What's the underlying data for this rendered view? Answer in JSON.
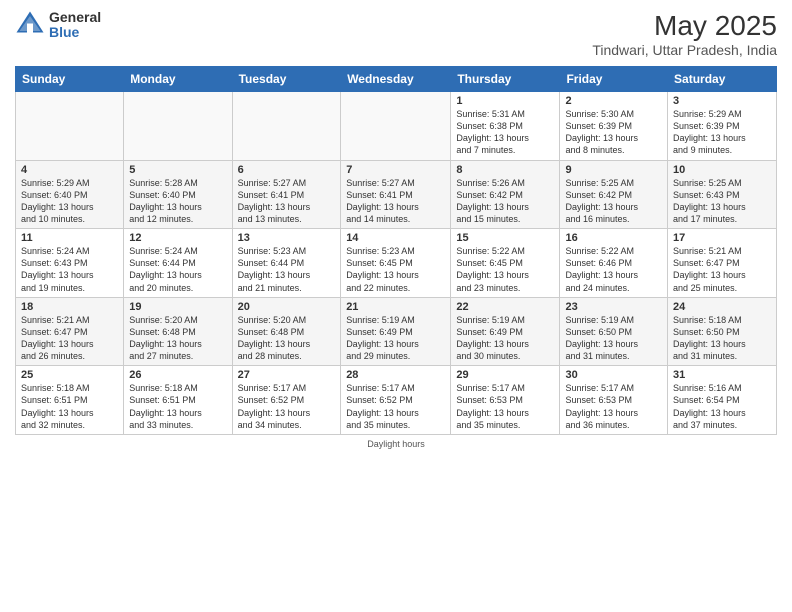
{
  "logo": {
    "general": "General",
    "blue": "Blue"
  },
  "header": {
    "month": "May 2025",
    "location": "Tindwari, Uttar Pradesh, India"
  },
  "days": [
    "Sunday",
    "Monday",
    "Tuesday",
    "Wednesday",
    "Thursday",
    "Friday",
    "Saturday"
  ],
  "weeks": [
    [
      {
        "day": "",
        "info": ""
      },
      {
        "day": "",
        "info": ""
      },
      {
        "day": "",
        "info": ""
      },
      {
        "day": "",
        "info": ""
      },
      {
        "day": "1",
        "info": "Sunrise: 5:31 AM\nSunset: 6:38 PM\nDaylight: 13 hours\nand 7 minutes."
      },
      {
        "day": "2",
        "info": "Sunrise: 5:30 AM\nSunset: 6:39 PM\nDaylight: 13 hours\nand 8 minutes."
      },
      {
        "day": "3",
        "info": "Sunrise: 5:29 AM\nSunset: 6:39 PM\nDaylight: 13 hours\nand 9 minutes."
      }
    ],
    [
      {
        "day": "4",
        "info": "Sunrise: 5:29 AM\nSunset: 6:40 PM\nDaylight: 13 hours\nand 10 minutes."
      },
      {
        "day": "5",
        "info": "Sunrise: 5:28 AM\nSunset: 6:40 PM\nDaylight: 13 hours\nand 12 minutes."
      },
      {
        "day": "6",
        "info": "Sunrise: 5:27 AM\nSunset: 6:41 PM\nDaylight: 13 hours\nand 13 minutes."
      },
      {
        "day": "7",
        "info": "Sunrise: 5:27 AM\nSunset: 6:41 PM\nDaylight: 13 hours\nand 14 minutes."
      },
      {
        "day": "8",
        "info": "Sunrise: 5:26 AM\nSunset: 6:42 PM\nDaylight: 13 hours\nand 15 minutes."
      },
      {
        "day": "9",
        "info": "Sunrise: 5:25 AM\nSunset: 6:42 PM\nDaylight: 13 hours\nand 16 minutes."
      },
      {
        "day": "10",
        "info": "Sunrise: 5:25 AM\nSunset: 6:43 PM\nDaylight: 13 hours\nand 17 minutes."
      }
    ],
    [
      {
        "day": "11",
        "info": "Sunrise: 5:24 AM\nSunset: 6:43 PM\nDaylight: 13 hours\nand 19 minutes."
      },
      {
        "day": "12",
        "info": "Sunrise: 5:24 AM\nSunset: 6:44 PM\nDaylight: 13 hours\nand 20 minutes."
      },
      {
        "day": "13",
        "info": "Sunrise: 5:23 AM\nSunset: 6:44 PM\nDaylight: 13 hours\nand 21 minutes."
      },
      {
        "day": "14",
        "info": "Sunrise: 5:23 AM\nSunset: 6:45 PM\nDaylight: 13 hours\nand 22 minutes."
      },
      {
        "day": "15",
        "info": "Sunrise: 5:22 AM\nSunset: 6:45 PM\nDaylight: 13 hours\nand 23 minutes."
      },
      {
        "day": "16",
        "info": "Sunrise: 5:22 AM\nSunset: 6:46 PM\nDaylight: 13 hours\nand 24 minutes."
      },
      {
        "day": "17",
        "info": "Sunrise: 5:21 AM\nSunset: 6:47 PM\nDaylight: 13 hours\nand 25 minutes."
      }
    ],
    [
      {
        "day": "18",
        "info": "Sunrise: 5:21 AM\nSunset: 6:47 PM\nDaylight: 13 hours\nand 26 minutes."
      },
      {
        "day": "19",
        "info": "Sunrise: 5:20 AM\nSunset: 6:48 PM\nDaylight: 13 hours\nand 27 minutes."
      },
      {
        "day": "20",
        "info": "Sunrise: 5:20 AM\nSunset: 6:48 PM\nDaylight: 13 hours\nand 28 minutes."
      },
      {
        "day": "21",
        "info": "Sunrise: 5:19 AM\nSunset: 6:49 PM\nDaylight: 13 hours\nand 29 minutes."
      },
      {
        "day": "22",
        "info": "Sunrise: 5:19 AM\nSunset: 6:49 PM\nDaylight: 13 hours\nand 30 minutes."
      },
      {
        "day": "23",
        "info": "Sunrise: 5:19 AM\nSunset: 6:50 PM\nDaylight: 13 hours\nand 31 minutes."
      },
      {
        "day": "24",
        "info": "Sunrise: 5:18 AM\nSunset: 6:50 PM\nDaylight: 13 hours\nand 31 minutes."
      }
    ],
    [
      {
        "day": "25",
        "info": "Sunrise: 5:18 AM\nSunset: 6:51 PM\nDaylight: 13 hours\nand 32 minutes."
      },
      {
        "day": "26",
        "info": "Sunrise: 5:18 AM\nSunset: 6:51 PM\nDaylight: 13 hours\nand 33 minutes."
      },
      {
        "day": "27",
        "info": "Sunrise: 5:17 AM\nSunset: 6:52 PM\nDaylight: 13 hours\nand 34 minutes."
      },
      {
        "day": "28",
        "info": "Sunrise: 5:17 AM\nSunset: 6:52 PM\nDaylight: 13 hours\nand 35 minutes."
      },
      {
        "day": "29",
        "info": "Sunrise: 5:17 AM\nSunset: 6:53 PM\nDaylight: 13 hours\nand 35 minutes."
      },
      {
        "day": "30",
        "info": "Sunrise: 5:17 AM\nSunset: 6:53 PM\nDaylight: 13 hours\nand 36 minutes."
      },
      {
        "day": "31",
        "info": "Sunrise: 5:16 AM\nSunset: 6:54 PM\nDaylight: 13 hours\nand 37 minutes."
      }
    ]
  ],
  "footer": {
    "daylight_label": "Daylight hours"
  }
}
